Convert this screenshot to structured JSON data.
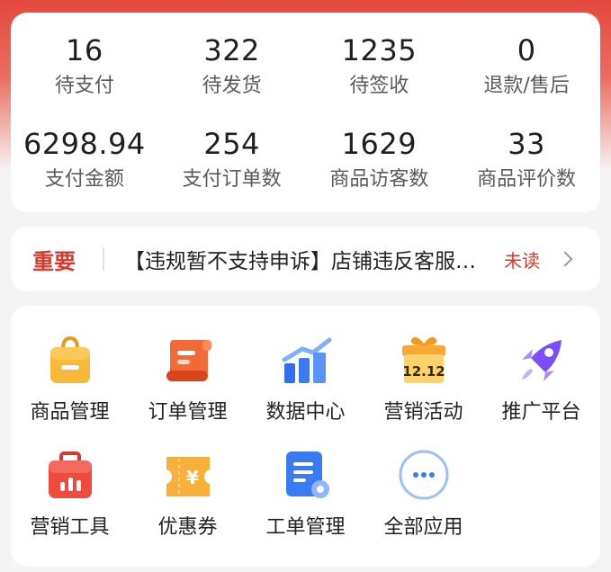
{
  "stats": [
    {
      "value": "16",
      "label": "待支付"
    },
    {
      "value": "322",
      "label": "待发货"
    },
    {
      "value": "1235",
      "label": "待签收"
    },
    {
      "value": "0",
      "label": "退款/售后"
    },
    {
      "value": "6298.94",
      "label": "支付金额"
    },
    {
      "value": "254",
      "label": "支付订单数"
    },
    {
      "value": "1629",
      "label": "商品访客数"
    },
    {
      "value": "33",
      "label": "商品评价数"
    }
  ],
  "notice": {
    "tag": "重要",
    "text": "【违规暂不支持申诉】店铺违反客服相关规则",
    "status": "未读"
  },
  "apps": [
    {
      "label": "商品管理",
      "icon": "shopping-bag-icon"
    },
    {
      "label": "订单管理",
      "icon": "order-scroll-icon"
    },
    {
      "label": "数据中心",
      "icon": "bar-chart-icon"
    },
    {
      "label": "营销活动",
      "icon": "gift-box-icon",
      "badge": "12.12"
    },
    {
      "label": "推广平台",
      "icon": "rocket-icon"
    },
    {
      "label": "营销工具",
      "icon": "toolbox-icon"
    },
    {
      "label": "优惠券",
      "icon": "coupon-icon",
      "symbol": "¥"
    },
    {
      "label": "工单管理",
      "icon": "ticket-document-icon"
    },
    {
      "label": "全部应用",
      "icon": "more-icon"
    }
  ],
  "colors": {
    "header_red": "#e4483e",
    "accent_red": "#e0352b",
    "icon_orange": "#f5a623",
    "icon_blue": "#3a7bf2",
    "icon_purple": "#7b4dff"
  }
}
